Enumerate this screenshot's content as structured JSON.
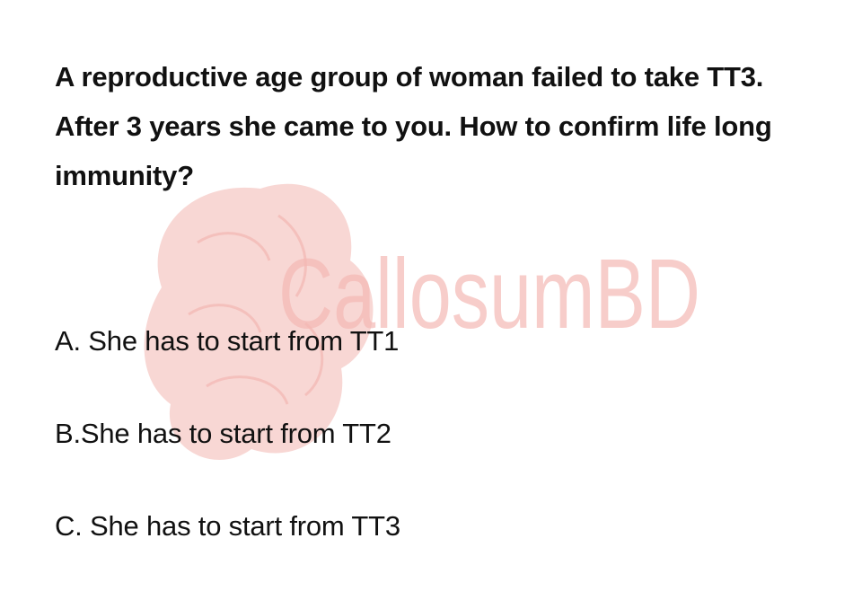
{
  "question": {
    "text": "A reproductive age group of woman failed to take TT3. After 3 years she came to you. How to confirm life long immunity?"
  },
  "options": [
    {
      "text": "A. She has to start from TT1"
    },
    {
      "text": "B.She has to start from TT2"
    },
    {
      "text": "C. She has to start from TT3"
    }
  ],
  "watermark": {
    "text": "CallosumBD",
    "icon": "brain-icon",
    "color": "#f4b8b4"
  }
}
